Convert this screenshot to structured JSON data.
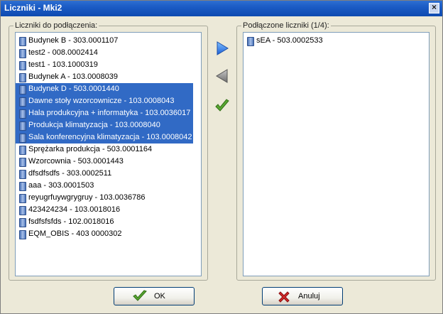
{
  "window": {
    "title": "Liczniki - Mki2",
    "close_glyph": "×"
  },
  "available": {
    "label": "Liczniki do podłączenia:",
    "items": [
      {
        "text": "Budynek B - 303.0001107",
        "selected": false
      },
      {
        "text": "test2 - 008.0002414",
        "selected": false
      },
      {
        "text": "test1 - 103.1000319",
        "selected": false
      },
      {
        "text": "Budynek A - 103.0008039",
        "selected": false
      },
      {
        "text": "Budynek D - 503.0001440",
        "selected": true
      },
      {
        "text": "Dawne stoły wzorcownicze - 103.0008043",
        "selected": true
      },
      {
        "text": "Hala produkcyjna + informatyka - 103.0036017",
        "selected": true
      },
      {
        "text": "Produkcja klimatyzacja - 103.0008040",
        "selected": true
      },
      {
        "text": "Sala konferencyjna klimatyzacja - 103.0008042",
        "selected": true
      },
      {
        "text": "Sprężarka produkcja - 503.0001164",
        "selected": false
      },
      {
        "text": "Wzorcownia - 503.0001443",
        "selected": false
      },
      {
        "text": "dfsdfsdfs - 303.0002511",
        "selected": false
      },
      {
        "text": "aaa - 303.0001503",
        "selected": false
      },
      {
        "text": "reyugrfuywgrygruy - 103.0036786",
        "selected": false
      },
      {
        "text": "423424234 - 103.0018016",
        "selected": false
      },
      {
        "text": "fsdfsfsfds - 102.0018016",
        "selected": false
      },
      {
        "text": "EQM_OBIS - 403 0000302",
        "selected": false
      }
    ]
  },
  "connected": {
    "label": "Podłączone liczniki (1/4):",
    "items": [
      {
        "text": "sEA - 503.0002533",
        "selected": false
      }
    ]
  },
  "buttons": {
    "ok": "OK",
    "cancel": "Anuluj"
  },
  "colors": {
    "selection": "#316ac5",
    "title_bar": "#1b5bc5",
    "arrow_active": "#2c7fe0",
    "arrow_inactive": "#7a7a7a",
    "check": "#5aa832",
    "cancel_x": "#d22a2a"
  },
  "icons": {
    "item": "meter-icon",
    "add": "arrow-right-icon",
    "remove": "arrow-left-icon",
    "confirm": "checkmark-icon"
  }
}
